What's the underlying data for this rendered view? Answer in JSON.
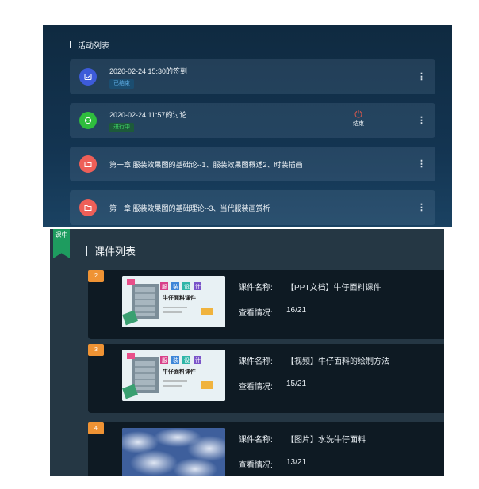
{
  "activities": {
    "title": "活动列表",
    "items": [
      {
        "icon": "checkin-icon",
        "title": "2020-02-24 15:30的签到",
        "status": "已结束",
        "color": "#3d5bd9"
      },
      {
        "icon": "discussion-icon",
        "title": "2020-02-24 11:57的讨论",
        "status": "进行中",
        "color": "#2fbd3d",
        "end_label": "结束"
      },
      {
        "icon": "folder-icon",
        "title": "第一章 服装效果图的基础论--1、服装效果图概述2、时装插画",
        "color": "#ee5f58"
      },
      {
        "icon": "folder-icon",
        "title": "第一章 服装效果图的基础理论--3、当代服装画赏析",
        "color": "#ee5f58"
      }
    ]
  },
  "courseware": {
    "ribbon": "课中",
    "title": "课件列表",
    "name_label": "课件名称:",
    "view_label": "查看情况:",
    "items": [
      {
        "index": "2",
        "name": "【PPT文档】牛仔面料课件",
        "views": "16/21",
        "thumb": "ppt",
        "thumb_tiles": [
          "服",
          "装",
          "设",
          "计"
        ],
        "thumb_caption": "牛仔面料课件"
      },
      {
        "index": "3",
        "name": "【视频】牛仔面料的绘制方法",
        "views": "15/21",
        "thumb": "ppt",
        "thumb_tiles": [
          "服",
          "装",
          "设",
          "计"
        ],
        "thumb_caption": "牛仔面料课件"
      },
      {
        "index": "4",
        "name": "【图片】水洗牛仔面料",
        "views": "13/21",
        "thumb": "denim"
      }
    ]
  }
}
